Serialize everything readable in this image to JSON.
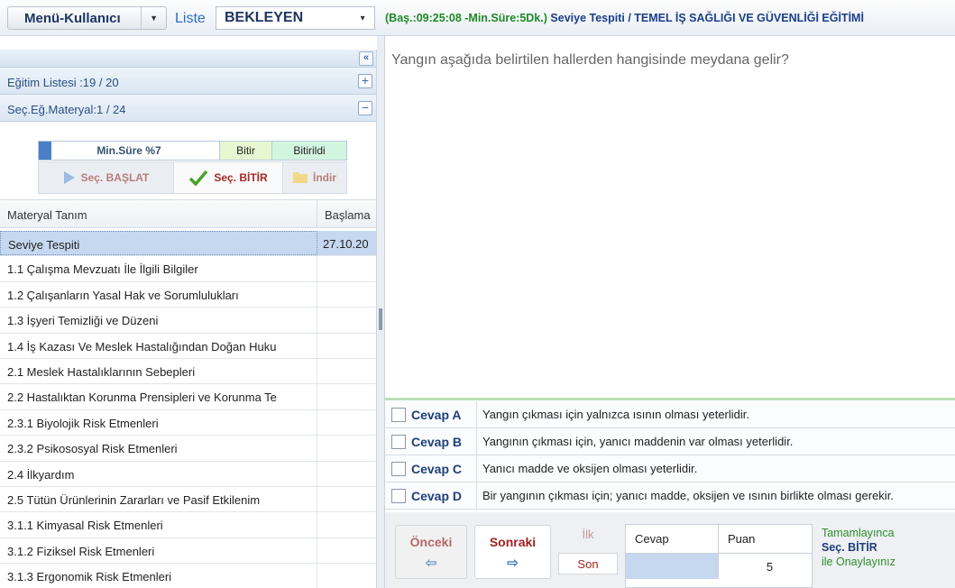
{
  "topbar": {
    "menu_label": "Menü-Kullanıcı",
    "liste_label": "Liste",
    "liste_value": "BEKLEYEN",
    "info_green": "(Baş.:09:25:08 -Min.Süre:5Dk.)",
    "info_blue": "Seviye Tespiti / TEMEL İŞ SAĞLIĞI VE GÜVENLİĞİ EĞİTİMİ"
  },
  "left": {
    "egitim_listesi": "Eğitim Listesi :19 / 20",
    "egitim_toggle": "+",
    "materyal": "Seç.Eğ.Materyal:1 / 24",
    "materyal_toggle": "−",
    "progress": {
      "label": "Min.Süre %7",
      "percent": 7,
      "bitir": "Bitir",
      "bitirildi": "Bitirildi"
    },
    "actions": {
      "start": "Seç. BAŞLAT",
      "end": "Seç. BİTİR",
      "download": "İndir"
    },
    "table": {
      "headers": [
        "Materyal Tanım",
        "Başlama"
      ],
      "rows": [
        {
          "name": "Seviye Tespiti",
          "date": "27.10.20"
        },
        {
          "name": "1.1 Çalışma Mevzuatı İle İlgili Bilgiler",
          "date": ""
        },
        {
          "name": "1.2 Çalışanların Yasal Hak ve Sorumlulukları",
          "date": ""
        },
        {
          "name": "1.3 İşyeri Temizliği ve Düzeni",
          "date": ""
        },
        {
          "name": "1.4 İş Kazası Ve Meslek Hastalığından Doğan Huku",
          "date": ""
        },
        {
          "name": "2.1 Meslek Hastalıklarının Sebepleri",
          "date": ""
        },
        {
          "name": "2.2 Hastalıktan Korunma Prensipleri ve Korunma Te",
          "date": ""
        },
        {
          "name": "2.3.1 Biyolojik Risk Etmenleri",
          "date": ""
        },
        {
          "name": "2.3.2 Psikososyal Risk Etmenleri",
          "date": ""
        },
        {
          "name": "2.4 İlkyardım",
          "date": ""
        },
        {
          "name": "2.5 Tütün Ürünlerinin Zararları ve Pasif Etkilenim",
          "date": ""
        },
        {
          "name": "3.1.1 Kimyasal Risk Etmenleri",
          "date": ""
        },
        {
          "name": "3.1.2 Fiziksel Risk Etmenleri",
          "date": ""
        },
        {
          "name": "3.1.3 Ergonomik Risk Etmenleri",
          "date": ""
        }
      ]
    }
  },
  "question": {
    "text": "Yangın aşağıda belirtilen hallerden hangisinde meydana gelir?",
    "answers": [
      {
        "label": "Cevap A",
        "text": "Yangın çıkması için yalnızca ısının olması yeterlidir."
      },
      {
        "label": "Cevap B",
        "text": "Yangının çıkması için, yanıcı maddenin var olması yeterlidir."
      },
      {
        "label": "Cevap C",
        "text": "Yanıcı madde ve oksijen olması yeterlidir."
      },
      {
        "label": "Cevap D",
        "text": "Bir yangının çıkması için; yanıcı madde, oksijen ve ısının birlikte olması gerekir."
      }
    ]
  },
  "bottom": {
    "prev": "Önceki",
    "next": "Sonraki",
    "first": "İlk",
    "last": "Son",
    "score_headers": [
      "Cevap",
      "Puan"
    ],
    "score_value": "5",
    "note_line1": "Tamamlayınca",
    "note_line2": "Seç. BİTİR",
    "note_line3": "ile Onaylayınız"
  }
}
